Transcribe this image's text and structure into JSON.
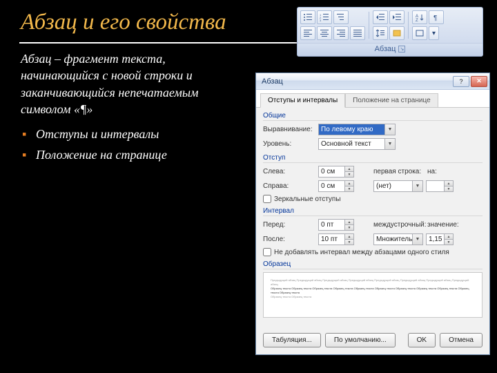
{
  "title": "Абзац и его свойства",
  "definition": "Абзац – фрагмент текста, начинающийся с новой строки и заканчивающийся непечатаемым символом «¶»",
  "bullets": [
    "Отступы и интервалы",
    "Положение на странице"
  ],
  "ribbon": {
    "label": "Абзац"
  },
  "dialog": {
    "title": "Абзац",
    "tabs": [
      "Отступы и интервалы",
      "Положение на странице"
    ],
    "groups": {
      "general": {
        "label": "Общие",
        "align_label": "Выравнивание:",
        "align_value": "По левому краю",
        "level_label": "Уровень:",
        "level_value": "Основной текст"
      },
      "indent": {
        "label": "Отступ",
        "left_label": "Слева:",
        "left_value": "0 см",
        "right_label": "Справа:",
        "right_value": "0 см",
        "first_label": "первая строка:",
        "first_value": "(нет)",
        "by_label": "на:",
        "by_value": "",
        "mirror": "Зеркальные отступы"
      },
      "spacing": {
        "label": "Интервал",
        "before_label": "Перед:",
        "before_value": "0 пт",
        "after_label": "После:",
        "after_value": "10 пт",
        "line_label": "междустрочный:",
        "line_value": "Множитель",
        "val_label": "значение:",
        "val_value": "1,15",
        "nospace": "Не добавлять интервал между абзацами одного стиля"
      },
      "preview": {
        "label": "Образец",
        "faint": "Предыдущий абзац Предыдущий абзац Предыдущий абзац Предыдущий абзац Предыдущий абзац Предыдущий абзац Предыдущий абзац Предыдущий абзац",
        "focus": "Образец текста Образец текста Образец текста Образец текста Образец текста Образец текста Образец текста Образец текста Образец текста Образец текста Образец текста",
        "faint2": "Образец текста Образец текста"
      }
    },
    "buttons": {
      "tabs": "Табуляция...",
      "default": "По умолчанию...",
      "ok": "OK",
      "cancel": "Отмена"
    }
  }
}
